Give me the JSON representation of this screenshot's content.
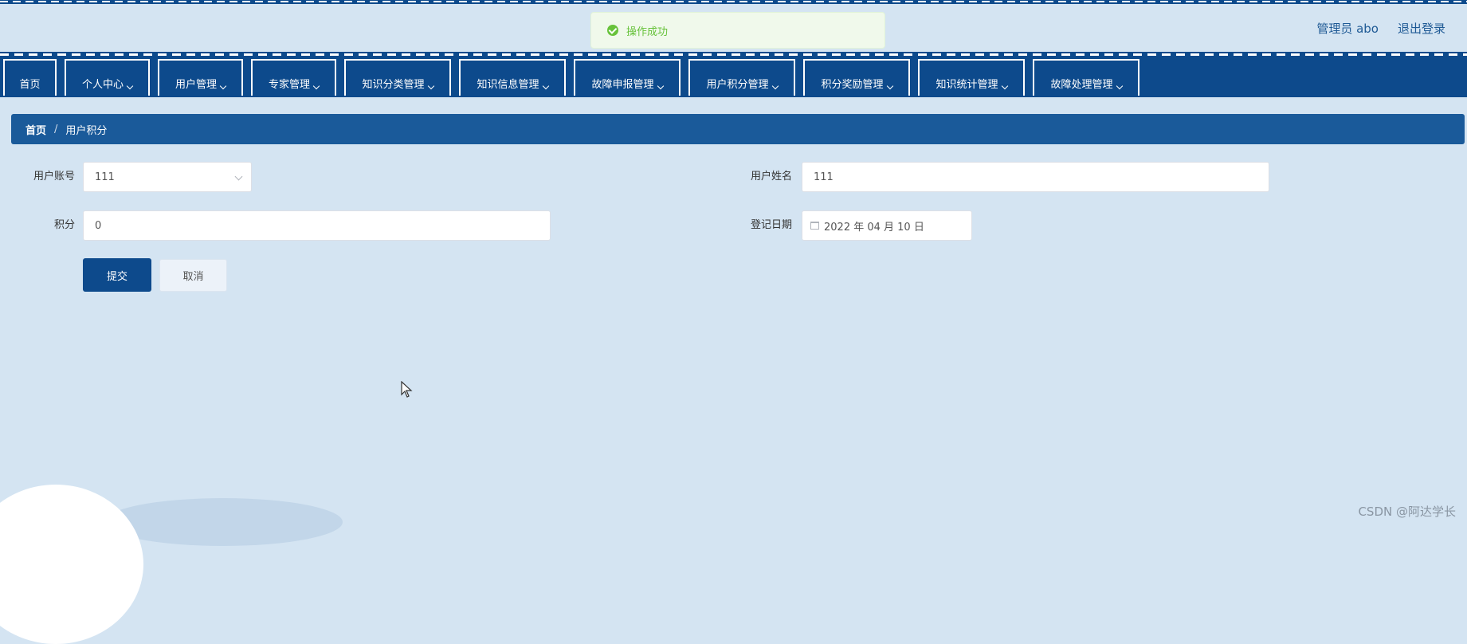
{
  "toast": {
    "text": "操作成功"
  },
  "user": {
    "role_name": "管理员 abo",
    "logout": "退出登录"
  },
  "nav": {
    "items": [
      {
        "label": "首页",
        "dropdown": false
      },
      {
        "label": "个人中心",
        "dropdown": true
      },
      {
        "label": "用户管理",
        "dropdown": true
      },
      {
        "label": "专家管理",
        "dropdown": true
      },
      {
        "label": "知识分类管理",
        "dropdown": true
      },
      {
        "label": "知识信息管理",
        "dropdown": true
      },
      {
        "label": "故障申报管理",
        "dropdown": true
      },
      {
        "label": "用户积分管理",
        "dropdown": true
      },
      {
        "label": "积分奖励管理",
        "dropdown": true
      },
      {
        "label": "知识统计管理",
        "dropdown": true
      },
      {
        "label": "故障处理管理",
        "dropdown": true
      }
    ]
  },
  "breadcrumb": {
    "home": "首页",
    "separator": "/",
    "current": "用户积分"
  },
  "form": {
    "account_label": "用户账号",
    "account_value": "111",
    "name_label": "用户姓名",
    "name_value": "111",
    "points_label": "积分",
    "points_value": "0",
    "date_label": "登记日期",
    "date_value": "2022 年 04 月 10 日",
    "submit": "提交",
    "cancel": "取消"
  },
  "watermark": "CSDN @阿达学长",
  "colors": {
    "primary": "#0d4a8c",
    "background": "#d4e4f2",
    "success": "#67c23a"
  }
}
